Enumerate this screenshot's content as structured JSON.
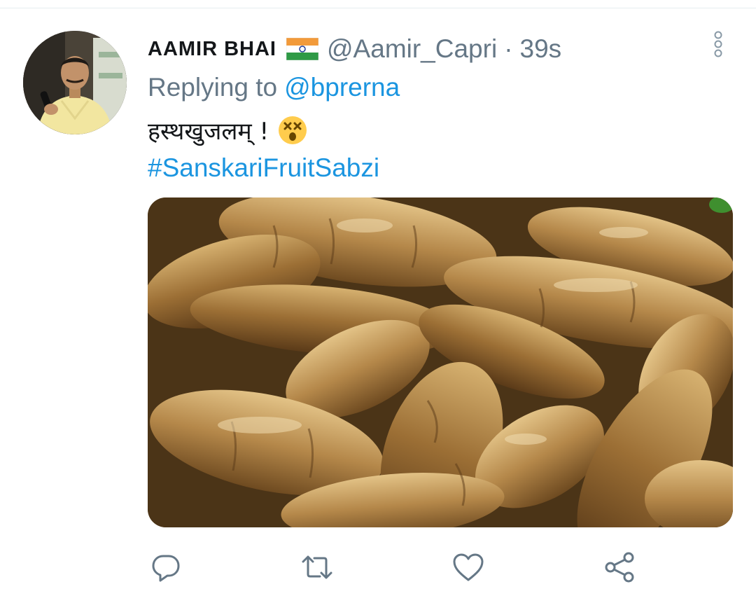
{
  "tweet": {
    "display_name": "AAMIR BHAI",
    "flag_icon": "india-flag-icon",
    "handle": "@Aamir_Capri",
    "separator": "·",
    "time": "39s",
    "replying_prefix": "Replying to",
    "replying_to": "@bprerna",
    "text": "हस्थखुजलम् !",
    "emoji_icon": "dizzy-face-emoji-icon",
    "hashtag": "#SanskariFruitSabzi",
    "media_description_icon": "yam-roots-photo"
  },
  "actions": {
    "reply_icon": "reply-icon",
    "retweet_icon": "retweet-icon",
    "like_icon": "heart-icon",
    "share_icon": "share-icon",
    "more_icon": "more-vertical-icon"
  },
  "colors": {
    "link": "#1b95e0",
    "secondary": "#657786",
    "primary": "#14171a"
  }
}
